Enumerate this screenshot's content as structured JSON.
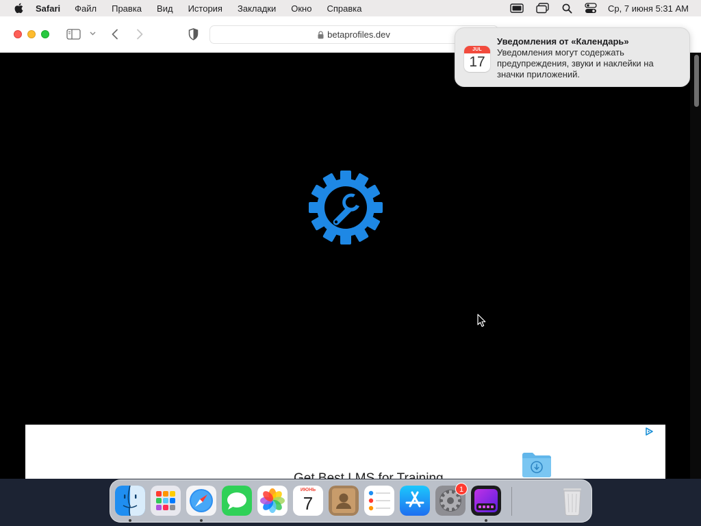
{
  "menubar": {
    "app_name": "Safari",
    "items": [
      "Файл",
      "Правка",
      "Вид",
      "История",
      "Закладки",
      "Окно",
      "Справка"
    ],
    "clock": "Ср, 7 июня  5:31 AM",
    "status_icons": [
      "display-icon",
      "screen-mirroring-icon",
      "spotlight-search-icon",
      "control-center-icon"
    ]
  },
  "safari": {
    "url": "betaprofiles.dev"
  },
  "page": {
    "background": "#000000",
    "gear_color": "#1e88e5",
    "ad": {
      "headline": "Get Best LMS for Training"
    }
  },
  "notification": {
    "icon_month": "JUL",
    "icon_day": "17",
    "title": "Уведомления от «Календарь»",
    "body": "Уведомления могут содержать предупреждения, звуки и наклейки на значки приложений."
  },
  "dock": {
    "apps": [
      "finder",
      "launchpad",
      "safari",
      "messages",
      "photos",
      "calendar",
      "contacts",
      "reminders",
      "app-store",
      "system-settings",
      "simulator"
    ],
    "calendar_month": "ИЮНЬ",
    "calendar_day": "7",
    "settings_badge": "1"
  }
}
